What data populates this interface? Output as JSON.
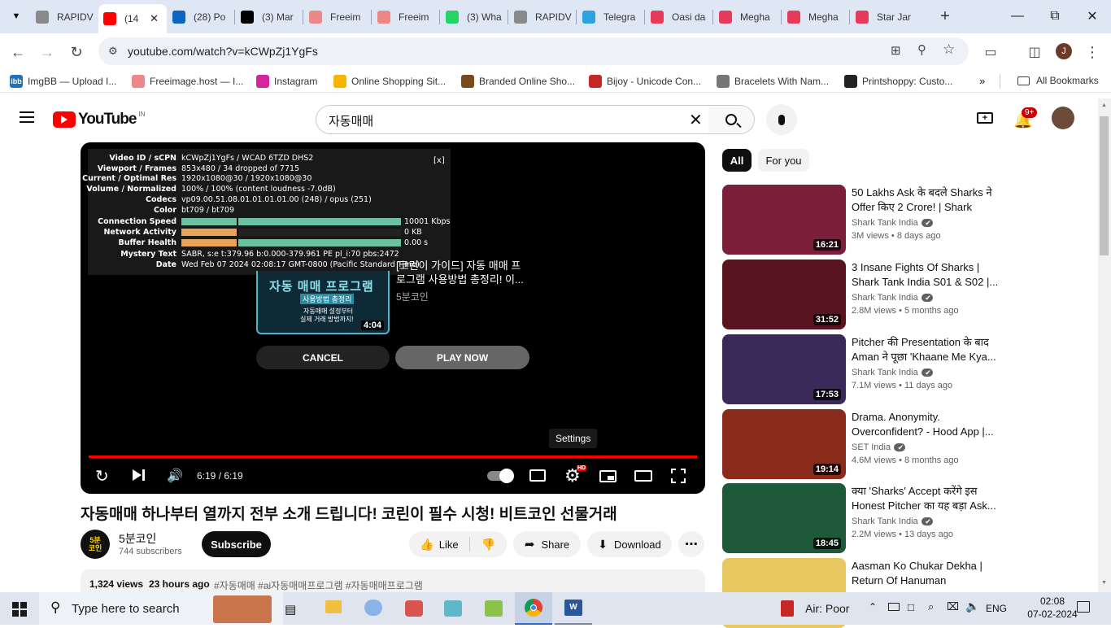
{
  "browser": {
    "tabs": [
      {
        "label": "RAPIDV",
        "color": "#8a8a8a"
      },
      {
        "label": "(14",
        "color": "#ff0000",
        "active": true
      },
      {
        "label": "(28) Po",
        "color": "#0a66c2"
      },
      {
        "label": "(3) Mar",
        "color": "#000000"
      },
      {
        "label": "Freeim",
        "color": "#e88"
      },
      {
        "label": "Freeim",
        "color": "#e88"
      },
      {
        "label": "(3) Wha",
        "color": "#25d366"
      },
      {
        "label": "RAPIDV",
        "color": "#8a8a8a"
      },
      {
        "label": "Telegra",
        "color": "#2aa3e0"
      },
      {
        "label": "Oasi da",
        "color": "#e63b5a"
      },
      {
        "label": "Megha",
        "color": "#e63b5a"
      },
      {
        "label": "Megha",
        "color": "#e63b5a"
      },
      {
        "label": "Star Jar",
        "color": "#e63b5a"
      }
    ],
    "url": "youtube.com/watch?v=kCWpZj1YgFs",
    "profile_initial": "J",
    "bookmarks": [
      {
        "label": "ImgBB — Upload I...",
        "color": "#1e73be",
        "glyph": "ibb"
      },
      {
        "label": "Freeimage.host — I...",
        "color": "#e88",
        "glyph": ""
      },
      {
        "label": "Instagram",
        "color": "#d6249f",
        "glyph": ""
      },
      {
        "label": "Online Shopping Sit...",
        "color": "#f7b500",
        "glyph": ""
      },
      {
        "label": "Branded Online Sho...",
        "color": "#7a4a1c",
        "glyph": ""
      },
      {
        "label": "Bijoy - Unicode Con...",
        "color": "#c62828",
        "glyph": ""
      },
      {
        "label": "Bracelets With Nam...",
        "color": "#777",
        "glyph": ""
      },
      {
        "label": "Printshoppy: Custo...",
        "color": "#222",
        "glyph": ""
      }
    ],
    "all_bookmarks": "All Bookmarks"
  },
  "youtube": {
    "logo_text": "YouTube",
    "logo_region": "IN",
    "search_query": "자동매매",
    "notification_count": "9+"
  },
  "player": {
    "stats": [
      {
        "k": "Video ID / sCPN",
        "v": "kCWpZj1YgFs / WCAD 6TZD DHS2"
      },
      {
        "k": "Viewport / Frames",
        "v": "853x480 / 34 dropped of 7715"
      },
      {
        "k": "Current / Optimal Res",
        "v": "1920x1080@30 / 1920x1080@30"
      },
      {
        "k": "Volume / Normalized",
        "v": "100% / 100% (content loudness -7.0dB)"
      },
      {
        "k": "Codecs",
        "v": "vp09.00.51.08.01.01.01.01.00 (248) / opus (251)"
      },
      {
        "k": "Color",
        "v": "bt709 / bt709"
      },
      {
        "k": "Connection Speed",
        "v": "10001 Kbps"
      },
      {
        "k": "Network Activity",
        "v": "0 KB"
      },
      {
        "k": "Buffer Health",
        "v": "0.00 s"
      },
      {
        "k": "Mystery Text",
        "v": "SABR, s:e t:379.96 b:0.000-379.961 PE pl_i:70 pbs:2472"
      },
      {
        "k": "Date",
        "v": "Wed Feb 07 2024 02:08:17 GMT-0800 (Pacific Standard Time)"
      }
    ],
    "stats_close": "[x]",
    "next_thumb_title_lines": [
      "자동 매매 프로그램",
      "사용방법 총정리",
      "자동매매 설정부터",
      "실제 거래 방법까지!"
    ],
    "next_duration": "4:04",
    "next_title": "[코린이 가이드] 자동 매매 프로그램 사용방법 총정리! 이...",
    "next_channel": "5분코인",
    "cancel_label": "CANCEL",
    "play_now_label": "PLAY NOW",
    "settings_tooltip": "Settings",
    "time": "6:19 / 6:19",
    "progress": 1.0,
    "hd_badge": "HD"
  },
  "video": {
    "title": "자동매매 하나부터 열까지 전부 소개 드립니다! 코린이 필수 시청! 비트코인 선물거래",
    "channel": "5분코인",
    "avatar_text": "5분\n코인",
    "subscribers": "744 subscribers",
    "subscribe_label": "Subscribe",
    "like_label": "Like",
    "share_label": "Share",
    "download_label": "Download",
    "views": "1,324 views",
    "age": "23 hours ago",
    "tags": "#자동매매 #ai자동매매프로그램 #자동매매프로그램"
  },
  "sidebar": {
    "chips": [
      {
        "label": "All",
        "active": true
      },
      {
        "label": "For you",
        "active": false
      }
    ],
    "recs": [
      {
        "title": "50 Lakhs Ask के बदले Sharks ने Offer किए 2 Crore! | Shark Tank...",
        "channel": "Shark Tank India",
        "views": "3M views",
        "age": "8 days ago",
        "duration": "16:21",
        "bg": "#7a1e3a"
      },
      {
        "title": "3 Insane Fights Of Sharks | Shark Tank India S01 & S02 |...",
        "channel": "Shark Tank India",
        "views": "2.8M views",
        "age": "5 months ago",
        "duration": "31:52",
        "bg": "#5a1420"
      },
      {
        "title": "Pitcher की Presentation के बाद Aman ने पूछा 'Khaane Me Kya...",
        "channel": "Shark Tank India",
        "views": "7.1M views",
        "age": "11 days ago",
        "duration": "17:53",
        "bg": "#3a2a5a"
      },
      {
        "title": "Drama. Anonymity. Overconfident? - Hood App |...",
        "channel": "SET India",
        "views": "4.6M views",
        "age": "8 months ago",
        "duration": "19:14",
        "bg": "#8a2a1a"
      },
      {
        "title": "क्या 'Sharks' Accept करेंगे इस Honest Pitcher का यह बड़ा Ask...",
        "channel": "Shark Tank India",
        "views": "2.2M views",
        "age": "13 days ago",
        "duration": "18:45",
        "bg": "#1e5a3a"
      },
      {
        "title": "Aasman Ko Chukar Dekha | Return Of Hanuman (Animatio...",
        "channel": "",
        "views": "",
        "age": "",
        "duration": "",
        "bg": "#e8c860"
      }
    ]
  },
  "taskbar": {
    "search_placeholder": "Type here to search",
    "weather": "Air: Poor",
    "lang": "ENG",
    "time": "02:08",
    "date": "07-02-2024"
  }
}
